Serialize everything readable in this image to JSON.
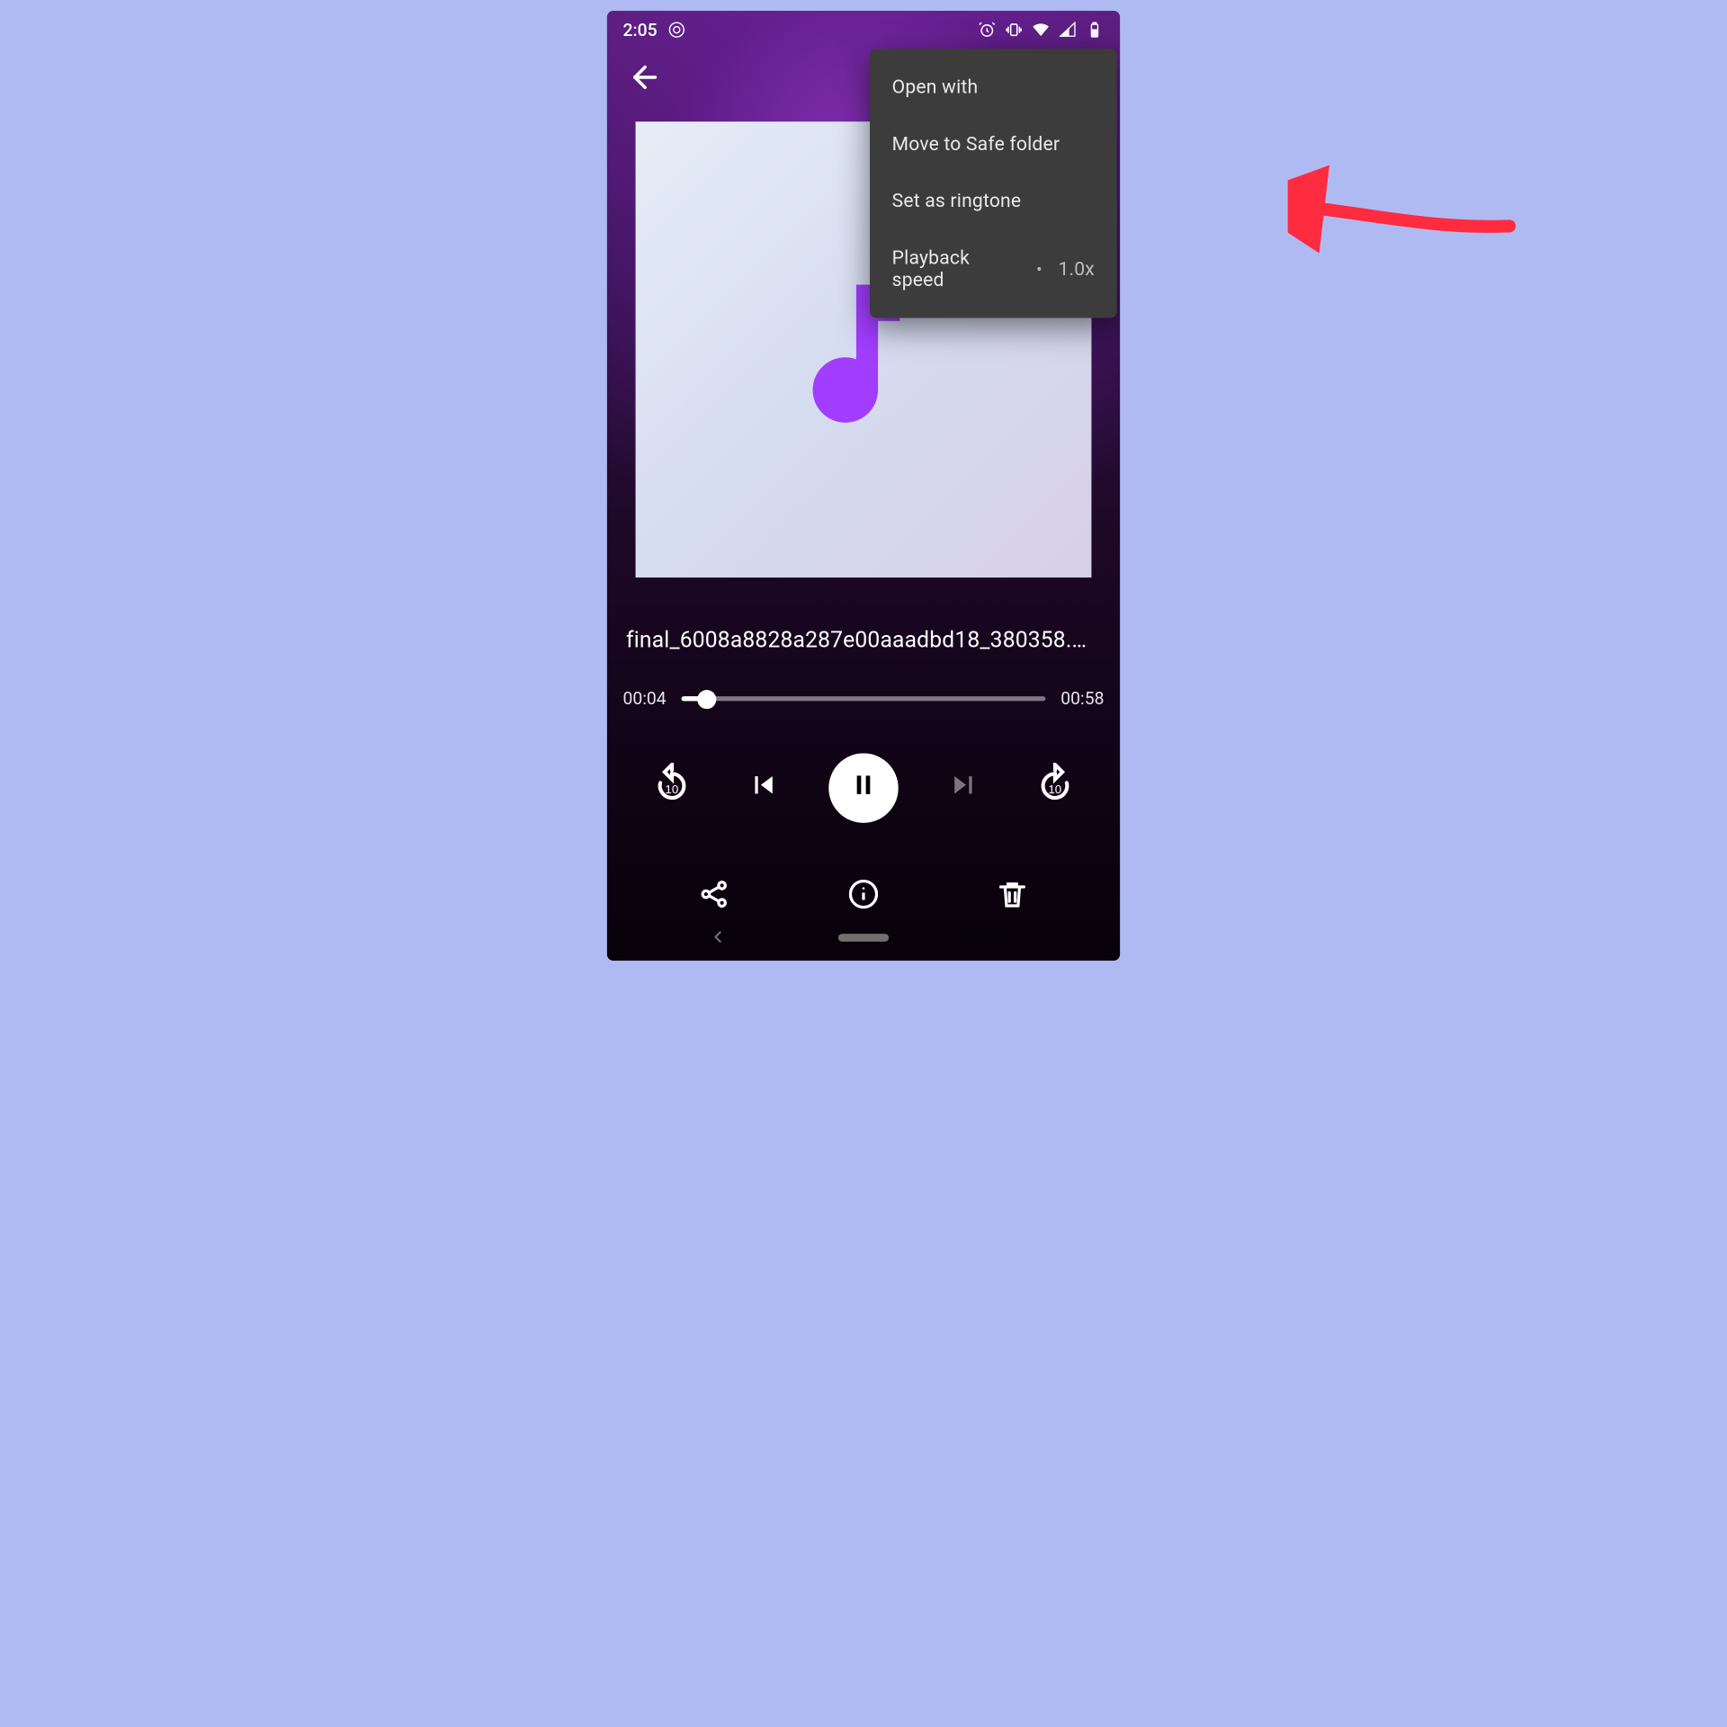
{
  "colors": {
    "accent": "#a23dff",
    "arrow": "#ff2b3f",
    "menu_bg": "#3c3c3c",
    "page_bg": "#b0baf2"
  },
  "status_bar": {
    "clock": "2:05",
    "left_icons": [
      "recording-dot-icon"
    ],
    "right_icons": [
      "alarm-icon",
      "vibrate-icon",
      "wifi-icon",
      "signal-icon",
      "battery-icon"
    ]
  },
  "app_bar": {
    "back_icon": "arrow-back-icon"
  },
  "overflow_menu": {
    "items": [
      {
        "id": "open-with",
        "label": "Open with"
      },
      {
        "id": "safe-folder",
        "label": "Move to Safe folder"
      },
      {
        "id": "ringtone",
        "label": "Set as ringtone"
      },
      {
        "id": "speed",
        "label": "Playback speed",
        "suffix_dot": "•",
        "suffix_value": "1.0x"
      }
    ]
  },
  "artwork_icon": "music-note-icon",
  "track": {
    "title": "final_6008a8828a287e00aaadbd18_380358.mp3"
  },
  "progress": {
    "elapsed": "00:04",
    "total": "00:58",
    "fraction": 0.07
  },
  "controls": {
    "row1": [
      {
        "id": "rewind10",
        "icon": "replay-10-icon",
        "interact": true
      },
      {
        "id": "prev",
        "icon": "skip-previous-icon",
        "interact": true
      },
      {
        "id": "play-pause",
        "icon": "pause-icon",
        "interact": true
      },
      {
        "id": "next",
        "icon": "skip-next-icon",
        "interact": false
      },
      {
        "id": "forward10",
        "icon": "forward-10-icon",
        "interact": true
      }
    ],
    "row2": [
      {
        "id": "share",
        "icon": "share-icon",
        "interact": true
      },
      {
        "id": "info",
        "icon": "info-icon",
        "interact": true
      },
      {
        "id": "delete",
        "icon": "trash-icon",
        "interact": true
      }
    ]
  },
  "nav_bar": {
    "icons": [
      "chevron-left-icon",
      "nav-pill"
    ]
  },
  "annotation": {
    "type": "arrow",
    "target_menu_item": "ringtone"
  }
}
